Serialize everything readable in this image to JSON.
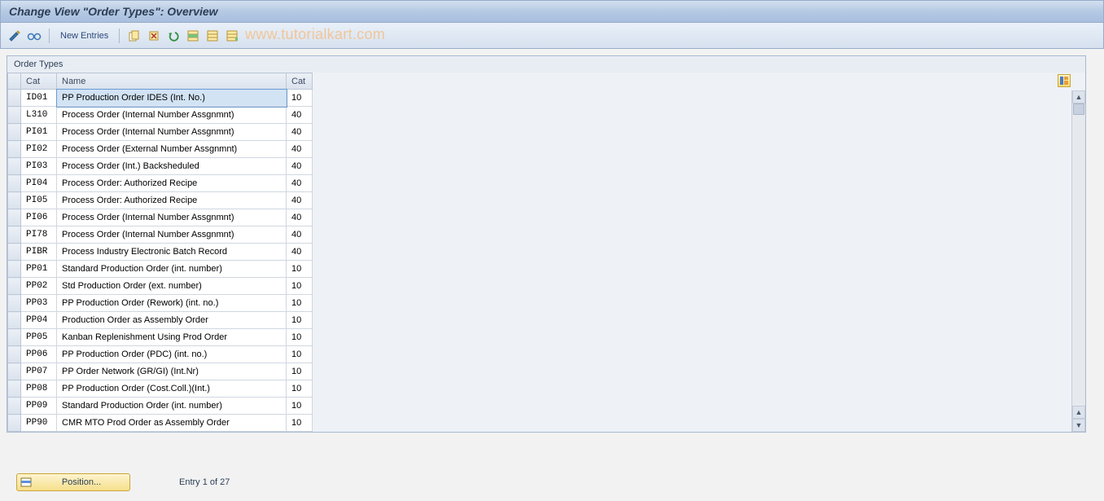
{
  "header": {
    "title": "Change View \"Order Types\": Overview"
  },
  "toolbar": {
    "new_entries": "New Entries",
    "watermark": "www.tutorialkart.com"
  },
  "panel": {
    "title": "Order Types",
    "columns": {
      "cat": "Cat",
      "name": "Name",
      "cat2": "Cat"
    },
    "rows": [
      {
        "cat": "ID01",
        "name": "PP Production Order IDES      (Int. No.)",
        "cat2": "10",
        "selected": true
      },
      {
        "cat": "L310",
        "name": "Process Order (Internal Number Assgnmnt)",
        "cat2": "40"
      },
      {
        "cat": "PI01",
        "name": "Process Order (Internal Number Assgnmnt)",
        "cat2": "40"
      },
      {
        "cat": "PI02",
        "name": "Process Order (External Number Assgnmnt)",
        "cat2": "40"
      },
      {
        "cat": "PI03",
        "name": "Process Order (Int.) Backsheduled",
        "cat2": "40"
      },
      {
        "cat": "PI04",
        "name": "Process Order: Authorized Recipe",
        "cat2": "40"
      },
      {
        "cat": "PI05",
        "name": "Process Order: Authorized Recipe",
        "cat2": "40"
      },
      {
        "cat": "PI06",
        "name": "Process Order (Internal Number Assgnmnt)",
        "cat2": "40"
      },
      {
        "cat": "PI78",
        "name": "Process Order (Internal Number Assgnmnt)",
        "cat2": "40"
      },
      {
        "cat": "PIBR",
        "name": "Process Industry Electronic Batch Record",
        "cat2": "40"
      },
      {
        "cat": "PP01",
        "name": "Standard Production Order (int. number)",
        "cat2": "10"
      },
      {
        "cat": "PP02",
        "name": "Std Production Order (ext. number)",
        "cat2": "10"
      },
      {
        "cat": "PP03",
        "name": "PP Production Order (Rework)  (int. no.)",
        "cat2": "10"
      },
      {
        "cat": "PP04",
        "name": "Production Order as Assembly Order",
        "cat2": "10"
      },
      {
        "cat": "PP05",
        "name": "Kanban Replenishment Using Prod Order",
        "cat2": "10"
      },
      {
        "cat": "PP06",
        "name": "PP Production Order (PDC)    (int. no.)",
        "cat2": "10"
      },
      {
        "cat": "PP07",
        "name": "PP Order Network      (GR/GI)   (Int.Nr)",
        "cat2": "10"
      },
      {
        "cat": "PP08",
        "name": "PP Production Order  (Cost.Coll.)(Int.)",
        "cat2": "10"
      },
      {
        "cat": "PP09",
        "name": "Standard Production Order (int. number)",
        "cat2": "10"
      },
      {
        "cat": "PP90",
        "name": "CMR MTO Prod Order as Assembly Order",
        "cat2": "10"
      }
    ]
  },
  "footer": {
    "position_label": "Position...",
    "entry_text": "Entry 1 of 27"
  }
}
